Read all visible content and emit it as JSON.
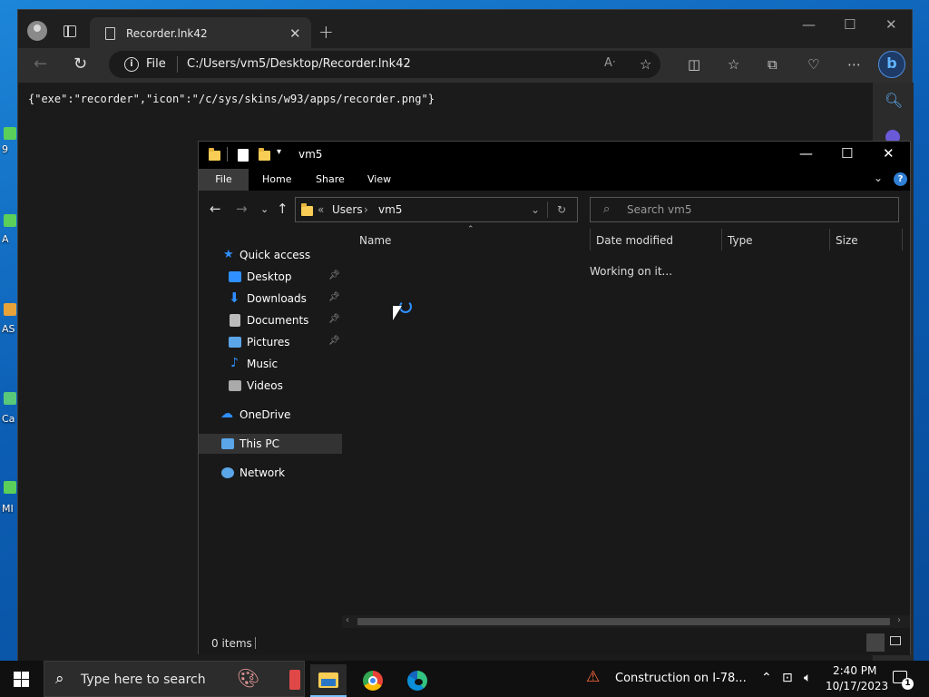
{
  "desktop": {
    "icon_labels": [
      "9",
      "A",
      "AS",
      "Ca",
      "MI"
    ]
  },
  "browser": {
    "tab_title": "Recorder.lnk42",
    "address": {
      "file_label": "File",
      "url": "C:/Users/vm5/Desktop/Recorder.lnk42"
    },
    "content_text": "{\"exe\":\"recorder\",\"icon\":\"/c/sys/skins/w93/apps/recorder.png\"}"
  },
  "explorer": {
    "title": "vm5",
    "ribbon_tabs": [
      "File",
      "Home",
      "Share",
      "View"
    ],
    "breadcrumb": {
      "overflow": "«",
      "items": [
        "Users",
        "vm5"
      ]
    },
    "search_placeholder": "Search vm5",
    "nav_items": [
      {
        "label": "Quick access",
        "icon": "star-icon",
        "color": "#2f8fff"
      },
      {
        "label": "Desktop",
        "icon": "desktop-folder-icon",
        "color": "#2f8fff",
        "pinned": true
      },
      {
        "label": "Downloads",
        "icon": "download-arrow-icon",
        "color": "#2f8fff",
        "pinned": true
      },
      {
        "label": "Documents",
        "icon": "documents-icon",
        "color": "#bbbbbb",
        "pinned": true
      },
      {
        "label": "Pictures",
        "icon": "pictures-icon",
        "color": "#5aa6e8",
        "pinned": true
      },
      {
        "label": "Music",
        "icon": "music-note-icon",
        "color": "#2f8fff"
      },
      {
        "label": "Videos",
        "icon": "videos-icon",
        "color": "#aaaaaa"
      },
      {
        "label": "OneDrive",
        "icon": "cloud-icon",
        "color": "#2f8fff"
      },
      {
        "label": "This PC",
        "icon": "computer-icon",
        "color": "#5aa6e8",
        "selected": true
      },
      {
        "label": "Network",
        "icon": "network-icon",
        "color": "#5aa6e8"
      }
    ],
    "columns": [
      "Name",
      "Date modified",
      "Type",
      "Size"
    ],
    "loading_text": "Working on it...",
    "status": "0 items"
  },
  "taskbar": {
    "search_placeholder": "Type here to search",
    "news": "Construction on I-78...",
    "time": "2:40 PM",
    "date": "10/17/2023",
    "notification_count": "1"
  }
}
